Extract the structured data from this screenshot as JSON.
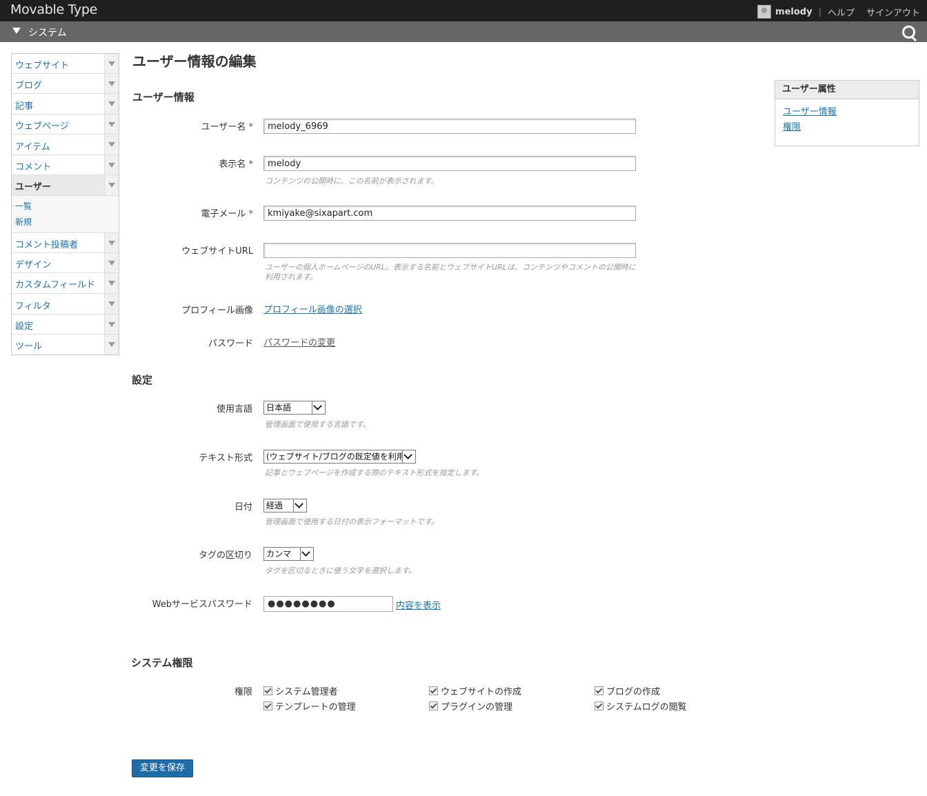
{
  "header": {
    "logo": "Movable Type",
    "username": "melody",
    "help": "ヘルプ",
    "signout": "サインアウト"
  },
  "scope": {
    "label": "システム"
  },
  "sidebar": {
    "items": [
      {
        "label": "ウェブサイト"
      },
      {
        "label": "ブログ"
      },
      {
        "label": "記事"
      },
      {
        "label": "ウェブページ"
      },
      {
        "label": "アイテム"
      },
      {
        "label": "コメント"
      },
      {
        "label": "ユーザー"
      },
      {
        "label": "コメント投稿者"
      },
      {
        "label": "デザイン"
      },
      {
        "label": "カスタムフィールド"
      },
      {
        "label": "フィルタ"
      },
      {
        "label": "設定"
      },
      {
        "label": "ツール"
      }
    ],
    "user_sub": [
      "一覧",
      "新規"
    ]
  },
  "page": {
    "title": "ユーザー情報の編集"
  },
  "user_info": {
    "heading": "ユーザー情報",
    "username_label": "ユーザー名",
    "username_value": "melody_6969",
    "display_label": "表示名",
    "display_value": "melody",
    "display_hint": "コンテンツの公開時に、この名前が表示されます。",
    "email_label": "電子メール",
    "email_value": "kmiyake@sixapart.com",
    "url_label": "ウェブサイトURL",
    "url_value": "",
    "url_hint": "ユーザーの個人ホームページのURL。表示する名前とウェブサイトURLは、コンテンツやコメントの公開時に利用されます。",
    "profile_label": "プロフィール画像",
    "profile_link": "プロフィール画像の選択",
    "password_label": "パスワード",
    "password_link": "パスワードの変更",
    "required_mark": "*"
  },
  "settings": {
    "heading": "設定",
    "lang_label": "使用言語",
    "lang_value": "日本語",
    "lang_hint": "管理画面で使用する言語です。",
    "text_label": "テキスト形式",
    "text_value": "(ウェブサイト/ブログの既定値を利用)",
    "text_hint": "記事とウェブページを作成する際のテキスト形式を指定します。",
    "date_label": "日付",
    "date_value": "経過",
    "date_hint": "管理画面で使用する日付の表示フォーマットです。",
    "tag_label": "タグの区切り",
    "tag_value": "カンマ",
    "tag_hint": "タグを区切るときに使う文字を選択します。",
    "ws_label": "Webサービスパスワード",
    "ws_value": "●●●●●●●●",
    "ws_link": "内容を表示"
  },
  "perms": {
    "heading": "システム権限",
    "label": "権限",
    "items": [
      {
        "label": "システム管理者",
        "checked": true
      },
      {
        "label": "ウェブサイトの作成",
        "checked": true
      },
      {
        "label": "ブログの作成",
        "checked": true
      },
      {
        "label": "テンプレートの管理",
        "checked": true
      },
      {
        "label": "プラグインの管理",
        "checked": true
      },
      {
        "label": "システムログの閲覧",
        "checked": true
      }
    ]
  },
  "save_label": "変更を保存",
  "attributes": {
    "heading": "ユーザー属性",
    "links": [
      "ユーザー情報",
      "権限"
    ]
  },
  "colors": {
    "link": "#1a72b4",
    "button": "#1d6ca8",
    "topbar": "#1f1f1f",
    "sysbar": "#666666"
  }
}
